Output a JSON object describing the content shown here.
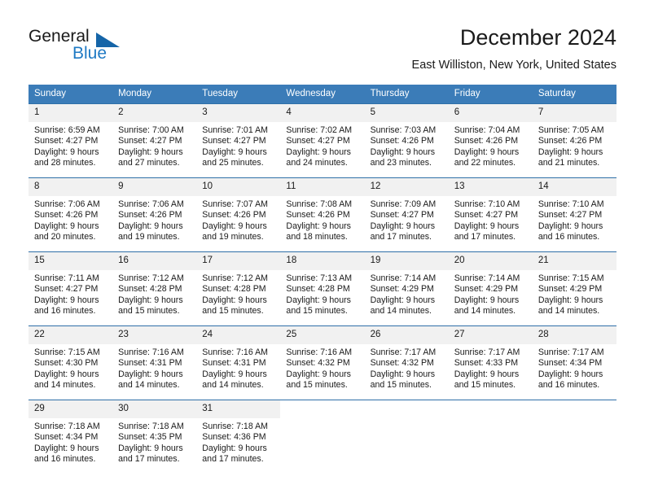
{
  "brand": {
    "name_top": "General",
    "name_bottom": "Blue",
    "triangle_color": "#1565a8",
    "blue_color": "#1f7ac4"
  },
  "header": {
    "title": "December 2024",
    "location": "East Williston, New York, United States"
  },
  "theme": {
    "header_bar": "#3b7cb8",
    "row_divider": "#2f6fa8",
    "daynum_band": "#f1f1f1"
  },
  "weekdays": [
    "Sunday",
    "Monday",
    "Tuesday",
    "Wednesday",
    "Thursday",
    "Friday",
    "Saturday"
  ],
  "labels": {
    "sunrise_prefix": "Sunrise:",
    "sunset_prefix": "Sunset:",
    "daylight_prefix": "Daylight:"
  },
  "weeks": [
    [
      {
        "day": "1",
        "sunrise": "Sunrise: 6:59 AM",
        "sunset": "Sunset: 4:27 PM",
        "daylight1": "Daylight: 9 hours",
        "daylight2": "and 28 minutes."
      },
      {
        "day": "2",
        "sunrise": "Sunrise: 7:00 AM",
        "sunset": "Sunset: 4:27 PM",
        "daylight1": "Daylight: 9 hours",
        "daylight2": "and 27 minutes."
      },
      {
        "day": "3",
        "sunrise": "Sunrise: 7:01 AM",
        "sunset": "Sunset: 4:27 PM",
        "daylight1": "Daylight: 9 hours",
        "daylight2": "and 25 minutes."
      },
      {
        "day": "4",
        "sunrise": "Sunrise: 7:02 AM",
        "sunset": "Sunset: 4:27 PM",
        "daylight1": "Daylight: 9 hours",
        "daylight2": "and 24 minutes."
      },
      {
        "day": "5",
        "sunrise": "Sunrise: 7:03 AM",
        "sunset": "Sunset: 4:26 PM",
        "daylight1": "Daylight: 9 hours",
        "daylight2": "and 23 minutes."
      },
      {
        "day": "6",
        "sunrise": "Sunrise: 7:04 AM",
        "sunset": "Sunset: 4:26 PM",
        "daylight1": "Daylight: 9 hours",
        "daylight2": "and 22 minutes."
      },
      {
        "day": "7",
        "sunrise": "Sunrise: 7:05 AM",
        "sunset": "Sunset: 4:26 PM",
        "daylight1": "Daylight: 9 hours",
        "daylight2": "and 21 minutes."
      }
    ],
    [
      {
        "day": "8",
        "sunrise": "Sunrise: 7:06 AM",
        "sunset": "Sunset: 4:26 PM",
        "daylight1": "Daylight: 9 hours",
        "daylight2": "and 20 minutes."
      },
      {
        "day": "9",
        "sunrise": "Sunrise: 7:06 AM",
        "sunset": "Sunset: 4:26 PM",
        "daylight1": "Daylight: 9 hours",
        "daylight2": "and 19 minutes."
      },
      {
        "day": "10",
        "sunrise": "Sunrise: 7:07 AM",
        "sunset": "Sunset: 4:26 PM",
        "daylight1": "Daylight: 9 hours",
        "daylight2": "and 19 minutes."
      },
      {
        "day": "11",
        "sunrise": "Sunrise: 7:08 AM",
        "sunset": "Sunset: 4:26 PM",
        "daylight1": "Daylight: 9 hours",
        "daylight2": "and 18 minutes."
      },
      {
        "day": "12",
        "sunrise": "Sunrise: 7:09 AM",
        "sunset": "Sunset: 4:27 PM",
        "daylight1": "Daylight: 9 hours",
        "daylight2": "and 17 minutes."
      },
      {
        "day": "13",
        "sunrise": "Sunrise: 7:10 AM",
        "sunset": "Sunset: 4:27 PM",
        "daylight1": "Daylight: 9 hours",
        "daylight2": "and 17 minutes."
      },
      {
        "day": "14",
        "sunrise": "Sunrise: 7:10 AM",
        "sunset": "Sunset: 4:27 PM",
        "daylight1": "Daylight: 9 hours",
        "daylight2": "and 16 minutes."
      }
    ],
    [
      {
        "day": "15",
        "sunrise": "Sunrise: 7:11 AM",
        "sunset": "Sunset: 4:27 PM",
        "daylight1": "Daylight: 9 hours",
        "daylight2": "and 16 minutes."
      },
      {
        "day": "16",
        "sunrise": "Sunrise: 7:12 AM",
        "sunset": "Sunset: 4:28 PM",
        "daylight1": "Daylight: 9 hours",
        "daylight2": "and 15 minutes."
      },
      {
        "day": "17",
        "sunrise": "Sunrise: 7:12 AM",
        "sunset": "Sunset: 4:28 PM",
        "daylight1": "Daylight: 9 hours",
        "daylight2": "and 15 minutes."
      },
      {
        "day": "18",
        "sunrise": "Sunrise: 7:13 AM",
        "sunset": "Sunset: 4:28 PM",
        "daylight1": "Daylight: 9 hours",
        "daylight2": "and 15 minutes."
      },
      {
        "day": "19",
        "sunrise": "Sunrise: 7:14 AM",
        "sunset": "Sunset: 4:29 PM",
        "daylight1": "Daylight: 9 hours",
        "daylight2": "and 14 minutes."
      },
      {
        "day": "20",
        "sunrise": "Sunrise: 7:14 AM",
        "sunset": "Sunset: 4:29 PM",
        "daylight1": "Daylight: 9 hours",
        "daylight2": "and 14 minutes."
      },
      {
        "day": "21",
        "sunrise": "Sunrise: 7:15 AM",
        "sunset": "Sunset: 4:29 PM",
        "daylight1": "Daylight: 9 hours",
        "daylight2": "and 14 minutes."
      }
    ],
    [
      {
        "day": "22",
        "sunrise": "Sunrise: 7:15 AM",
        "sunset": "Sunset: 4:30 PM",
        "daylight1": "Daylight: 9 hours",
        "daylight2": "and 14 minutes."
      },
      {
        "day": "23",
        "sunrise": "Sunrise: 7:16 AM",
        "sunset": "Sunset: 4:31 PM",
        "daylight1": "Daylight: 9 hours",
        "daylight2": "and 14 minutes."
      },
      {
        "day": "24",
        "sunrise": "Sunrise: 7:16 AM",
        "sunset": "Sunset: 4:31 PM",
        "daylight1": "Daylight: 9 hours",
        "daylight2": "and 14 minutes."
      },
      {
        "day": "25",
        "sunrise": "Sunrise: 7:16 AM",
        "sunset": "Sunset: 4:32 PM",
        "daylight1": "Daylight: 9 hours",
        "daylight2": "and 15 minutes."
      },
      {
        "day": "26",
        "sunrise": "Sunrise: 7:17 AM",
        "sunset": "Sunset: 4:32 PM",
        "daylight1": "Daylight: 9 hours",
        "daylight2": "and 15 minutes."
      },
      {
        "day": "27",
        "sunrise": "Sunrise: 7:17 AM",
        "sunset": "Sunset: 4:33 PM",
        "daylight1": "Daylight: 9 hours",
        "daylight2": "and 15 minutes."
      },
      {
        "day": "28",
        "sunrise": "Sunrise: 7:17 AM",
        "sunset": "Sunset: 4:34 PM",
        "daylight1": "Daylight: 9 hours",
        "daylight2": "and 16 minutes."
      }
    ],
    [
      {
        "day": "29",
        "sunrise": "Sunrise: 7:18 AM",
        "sunset": "Sunset: 4:34 PM",
        "daylight1": "Daylight: 9 hours",
        "daylight2": "and 16 minutes."
      },
      {
        "day": "30",
        "sunrise": "Sunrise: 7:18 AM",
        "sunset": "Sunset: 4:35 PM",
        "daylight1": "Daylight: 9 hours",
        "daylight2": "and 17 minutes."
      },
      {
        "day": "31",
        "sunrise": "Sunrise: 7:18 AM",
        "sunset": "Sunset: 4:36 PM",
        "daylight1": "Daylight: 9 hours",
        "daylight2": "and 17 minutes."
      },
      {
        "day": "",
        "sunrise": "",
        "sunset": "",
        "daylight1": "",
        "daylight2": ""
      },
      {
        "day": "",
        "sunrise": "",
        "sunset": "",
        "daylight1": "",
        "daylight2": ""
      },
      {
        "day": "",
        "sunrise": "",
        "sunset": "",
        "daylight1": "",
        "daylight2": ""
      },
      {
        "day": "",
        "sunrise": "",
        "sunset": "",
        "daylight1": "",
        "daylight2": ""
      }
    ]
  ]
}
